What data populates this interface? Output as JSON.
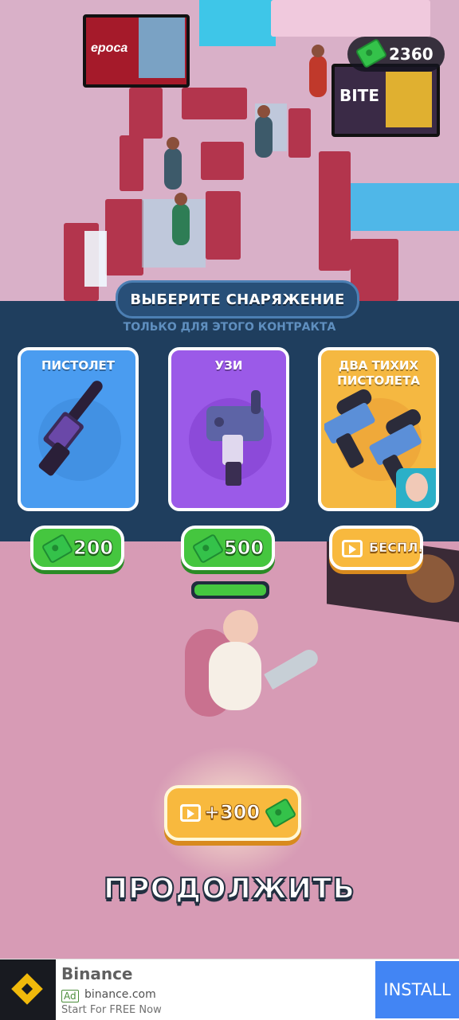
{
  "hud": {
    "money": "2360"
  },
  "scene": {
    "billboard_left": "epoca",
    "billboard_right": "BITE"
  },
  "loadout": {
    "title": "ВЫБЕРИТЕ СНАРЯЖЕНИЕ",
    "subtitle": "ТОЛЬКО ДЛЯ ЭТОГО КОНТРАКТА",
    "items": [
      {
        "name": "ПИСТОЛЕТ",
        "price": "200",
        "price_type": "cash",
        "icon": "silenced-pistol-icon",
        "color": "#4a9cf0"
      },
      {
        "name": "УЗИ",
        "price": "500",
        "price_type": "cash",
        "icon": "uzi-icon",
        "color": "#9b5ae8"
      },
      {
        "name": "ДВА ТИХИХ ПИСТОЛЕТА",
        "price": "БЕСПЛ.",
        "price_type": "video",
        "icon": "dual-pistols-icon",
        "color": "#f5b841"
      }
    ]
  },
  "player": {
    "health_fraction": 1.0
  },
  "bonus": {
    "label": "+300"
  },
  "continue_label": "ПРОДОЛЖИТЬ",
  "ad": {
    "title": "Binance",
    "badge": "Ad",
    "domain": "binance.com",
    "tagline": "Start For FREE Now",
    "install_label": "INSTALL"
  }
}
